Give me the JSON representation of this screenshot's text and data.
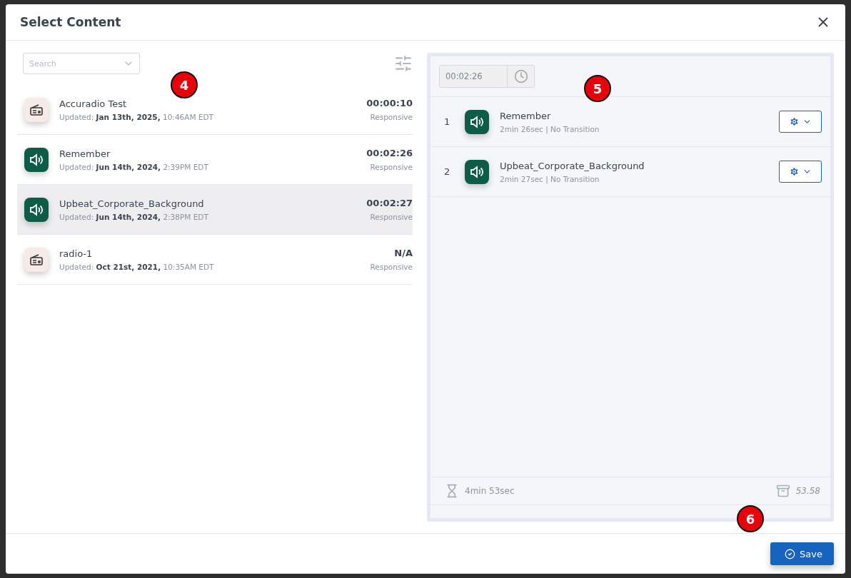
{
  "dialog": {
    "title": "Select Content"
  },
  "library": {
    "search": {
      "placeholder": "Search"
    },
    "items": [
      {
        "kind": "radio",
        "name": "Accuradio Test",
        "updated": "Updated: **Jan 13th, 2025,** 10:46AM EDT",
        "duration": "00:00:10",
        "mode": "Responsive",
        "selected": false
      },
      {
        "kind": "audio",
        "name": "Remember",
        "updated": "Updated: **Jun 14th, 2024,** 2:39PM EDT",
        "duration": "00:02:26",
        "mode": "Responsive",
        "selected": false
      },
      {
        "kind": "audio",
        "name": "Upbeat_Corporate_Background",
        "updated": "Updated: **Jun 14th, 2024,** 2:38PM EDT",
        "duration": "00:02:27",
        "mode": "Responsive",
        "selected": true
      },
      {
        "kind": "radio",
        "name": "radio-1",
        "updated": "Updated: **Oct 21st, 2021,** 10:35AM EDT",
        "duration": "N/A",
        "mode": "Responsive",
        "selected": false
      }
    ]
  },
  "playlist": {
    "time": "00:02:26",
    "items": [
      {
        "index": "1",
        "kind": "audio",
        "name": "Remember",
        "details": "2min 26sec | No Transition"
      },
      {
        "index": "2",
        "kind": "audio",
        "name": "Upbeat_Corporate_Background",
        "details": "2min 27sec | No Transition"
      }
    ],
    "total_duration": "4min 53sec",
    "size": "53.58"
  },
  "save_button": "Save",
  "callouts": [
    "4",
    "5",
    "6"
  ]
}
